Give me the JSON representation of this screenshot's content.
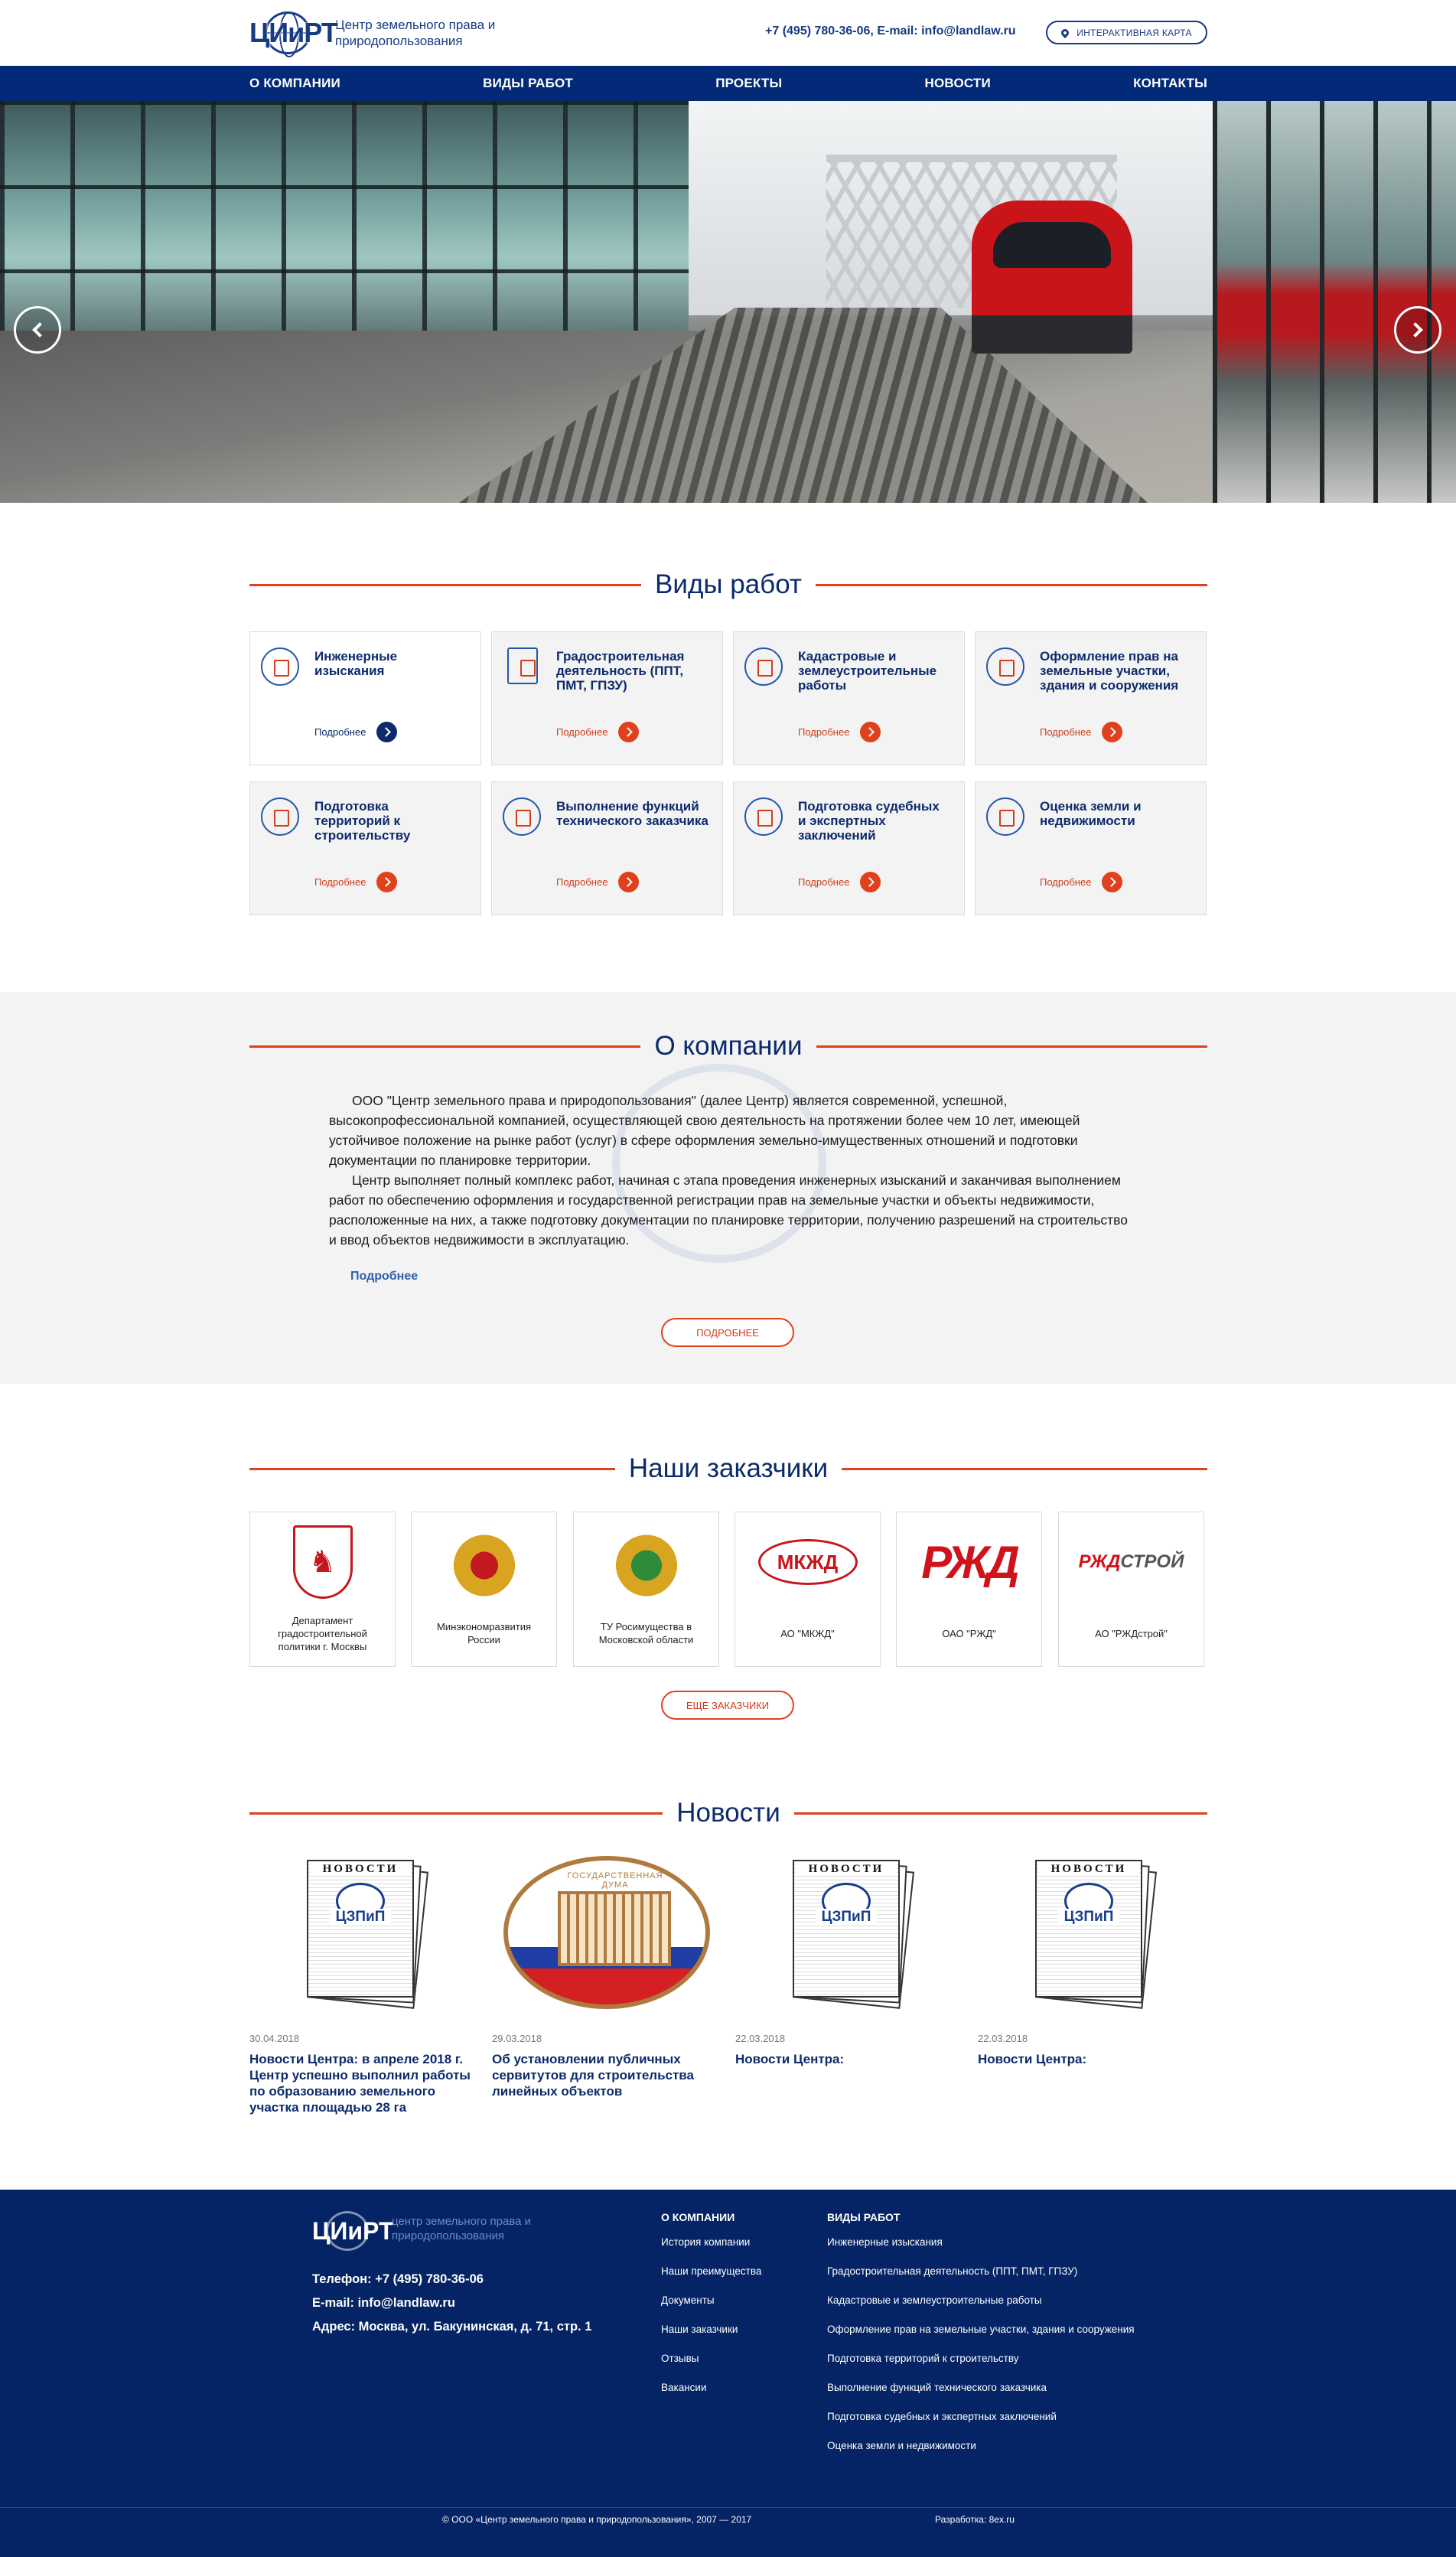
{
  "header": {
    "logo_abbr": "ЦИиРТ",
    "logo_text": "Центр земельного права и природопользования",
    "contacts": "+7 (495) 780-36-06,  E-mail: info@landlaw.ru",
    "map_button": "ИНТЕРАКТИВНАЯ КАРТА"
  },
  "nav": {
    "items": [
      "О КОМПАНИИ",
      "ВИДЫ РАБОТ",
      "ПРОЕКТЫ",
      "НОВОСТИ",
      "КОНТАКТЫ"
    ]
  },
  "services": {
    "title": "Виды работ",
    "items": [
      {
        "title": "Инженерные изыскания",
        "more": "Подробнее",
        "icon": "survey-icon"
      },
      {
        "title": "Градостроительная деятельность (ППТ, ПМТ, ГПЗУ)",
        "more": "Подробнее",
        "icon": "urban-plan-icon"
      },
      {
        "title": "Кадастровые и землеустроительные работы",
        "more": "Подробнее",
        "icon": "cadastre-icon"
      },
      {
        "title": "Оформление прав на земельные участки, здания и сооружения",
        "more": "Подробнее",
        "icon": "rights-document-icon"
      },
      {
        "title": "Подготовка территорий к строительству",
        "more": "Подробнее",
        "icon": "construction-icon"
      },
      {
        "title": "Выполнение функций технического заказчика",
        "more": "Подробнее",
        "icon": "customer-icon"
      },
      {
        "title": "Подготовка судебных и экспертных заключений",
        "more": "Подробнее",
        "icon": "expertise-icon"
      },
      {
        "title": "Оценка земли и недвижимости",
        "more": "Подробнее",
        "icon": "valuation-icon"
      }
    ]
  },
  "about": {
    "title": "О компании",
    "p1": "ООО \"Центр земельного права и природопользования\" (далее Центр) является современной, успешной, высокопрофессиональной компанией, осуществляющей свою деятельность на протяжении более чем 10 лет, имеющей устойчивое положение на рынке работ (услуг) в сфере оформления земельно-имущественных отношений и подготовки документации по планировке территории.",
    "p2": "Центр выполняет полный комплекс работ, начиная с этапа проведения инженерных изысканий и заканчивая выполнением работ по обеспечению оформления и государственной регистрации прав на земельные участки и объекты недвижимости, расположенные на них, а также подготовку документации по планировке территории, получению разрешений на строительство и ввод объектов недвижимости в эксплуатацию.",
    "link": "Подробнее",
    "button": "ПОДРОБНЕЕ"
  },
  "clients": {
    "title": "Наши заказчики",
    "items": [
      {
        "name": "Департамент градостроительной политики г. Москвы"
      },
      {
        "name": "Минэкономразвития России"
      },
      {
        "name": "ТУ Росимущества в Московской области"
      },
      {
        "name": "АО \"МКЖД\"",
        "logo": "МКЖД"
      },
      {
        "name": "ОАО \"РЖД\"",
        "logo": "РЖД"
      },
      {
        "name": "АО \"РЖДстрой\"",
        "logo_a": "РЖД",
        "logo_b": "СТРОЙ"
      }
    ],
    "button": "ЕЩЕ ЗАКАЗЧИКИ"
  },
  "news": {
    "title": "Новости",
    "paper_head": "НОВОСТИ",
    "paper_brand": "ЦЗПиП",
    "duma_label": "ГОСУДАРСТВЕННАЯ ДУМА",
    "items": [
      {
        "date": "30.04.2018",
        "title": "Новости Центра: в апреле 2018 г. Центр успешно выполнил работы по образованию земельного участка площадью 28 га"
      },
      {
        "date": "29.03.2018",
        "title": "Об установлении публичных сервитутов для строительства линейных объектов"
      },
      {
        "date": "22.03.2018",
        "title": "Новости Центра:"
      },
      {
        "date": "22.03.2018",
        "title": "Новости Центра:"
      }
    ]
  },
  "footer": {
    "logo_abbr": "ЦИиРТ",
    "logo_text": "центр земельного права и природопользования",
    "phone": "Телефон: +7 (495) 780-36-06",
    "email": "E-mail: info@landlaw.ru",
    "address": "Адрес: Москва, ул. Бакунинская, д. 71, стр. 1",
    "col1": {
      "head": "О КОМПАНИИ",
      "items": [
        "История компании",
        "Наши преимущества",
        "Документы",
        "Наши заказчики",
        "Отзывы",
        "Вакансии"
      ]
    },
    "col2": {
      "head": "ВИДЫ РАБОТ",
      "items": [
        "Инженерные изыскания",
        "Градостроительная деятельность (ППТ, ПМТ, ГПЗУ)",
        "Кадастровые и землеустроительные работы",
        "Оформление прав на земельные участки, здания и сооружения",
        "Подготовка территорий к строительству",
        "Выполнение функций технического заказчика",
        "Подготовка судебных и экспертных заключений",
        "Оценка земли и недвижимости"
      ]
    },
    "copyright": "© ООО «Центр земельного права и природопользования», 2007 — 2017",
    "developer": "Разработка: 8ex.ru"
  },
  "colors": {
    "brand_blue": "#032a78",
    "accent_red": "#e0401c",
    "footer_blue": "#042465"
  }
}
